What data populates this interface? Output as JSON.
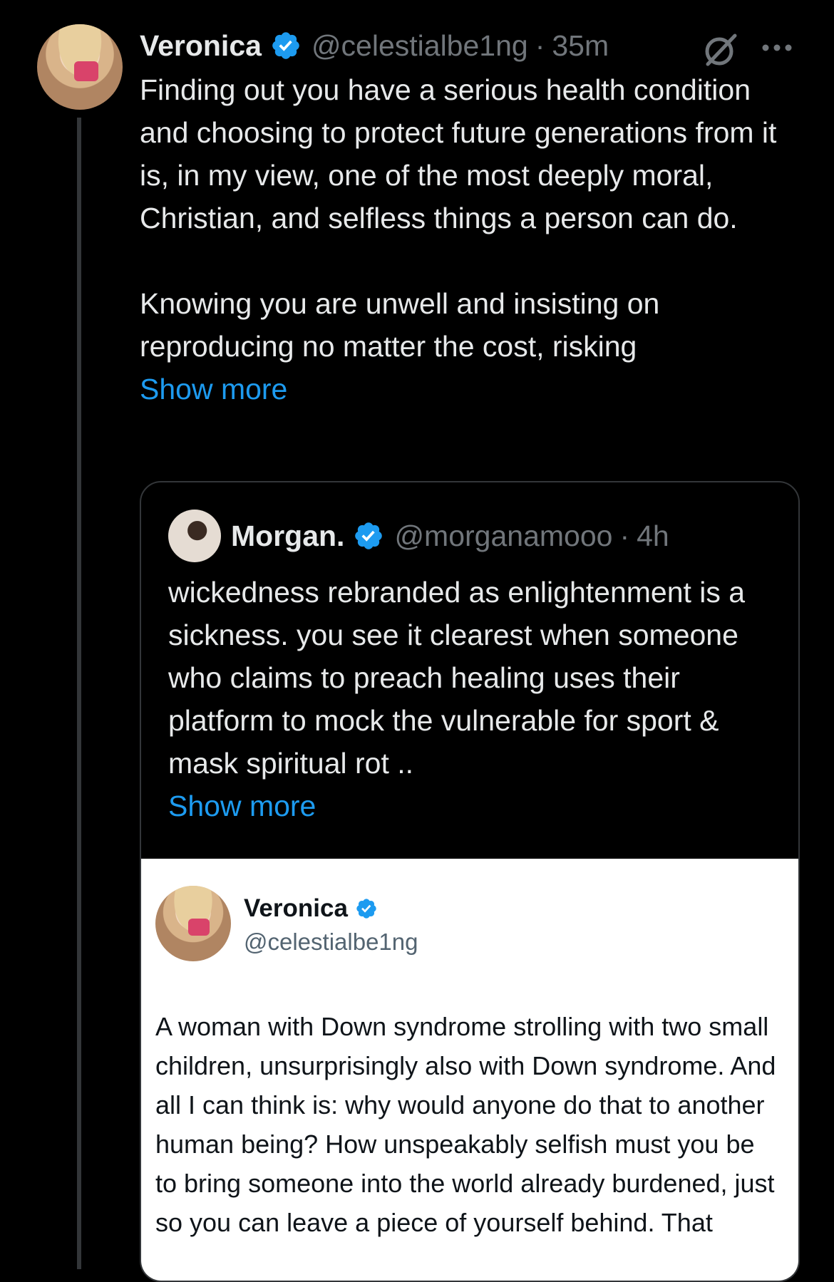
{
  "post": {
    "author_name": "Veronica",
    "handle": "@celestialbe1ng",
    "separator": "·",
    "time": "35m",
    "text_p1": "Finding out you have a serious health condition and choosing to protect future generations from it is, in my view, one of the most deeply moral, Christian, and selfless things a person can do.",
    "text_p2": "Knowing you are unwell and insisting on reproducing no matter the cost, risking",
    "show_more": "Show more",
    "verified_icon": "verified-badge-icon",
    "accent_color": "#1d9bf0"
  },
  "quote": {
    "author_name": "Morgan.",
    "handle": "@morganamooo",
    "separator": "·",
    "time": "4h",
    "text": "wickedness rebranded as enlightenment is a sickness. you see it clearest when someone who claims to preach healing uses their platform to mock the vulnerable for sport & mask spiritual rot ..",
    "show_more": "Show more"
  },
  "embedded_post": {
    "author_name": "Veronica",
    "handle": "@celestialbe1ng",
    "text": "A woman with Down syndrome strolling with two small children, unsurprisingly also with Down syndrome. And all I can think is: why would anyone do that to another human being? How unspeakably selfish must you be to bring someone into the world already burdened, just so you can leave a piece of yourself behind. That"
  }
}
